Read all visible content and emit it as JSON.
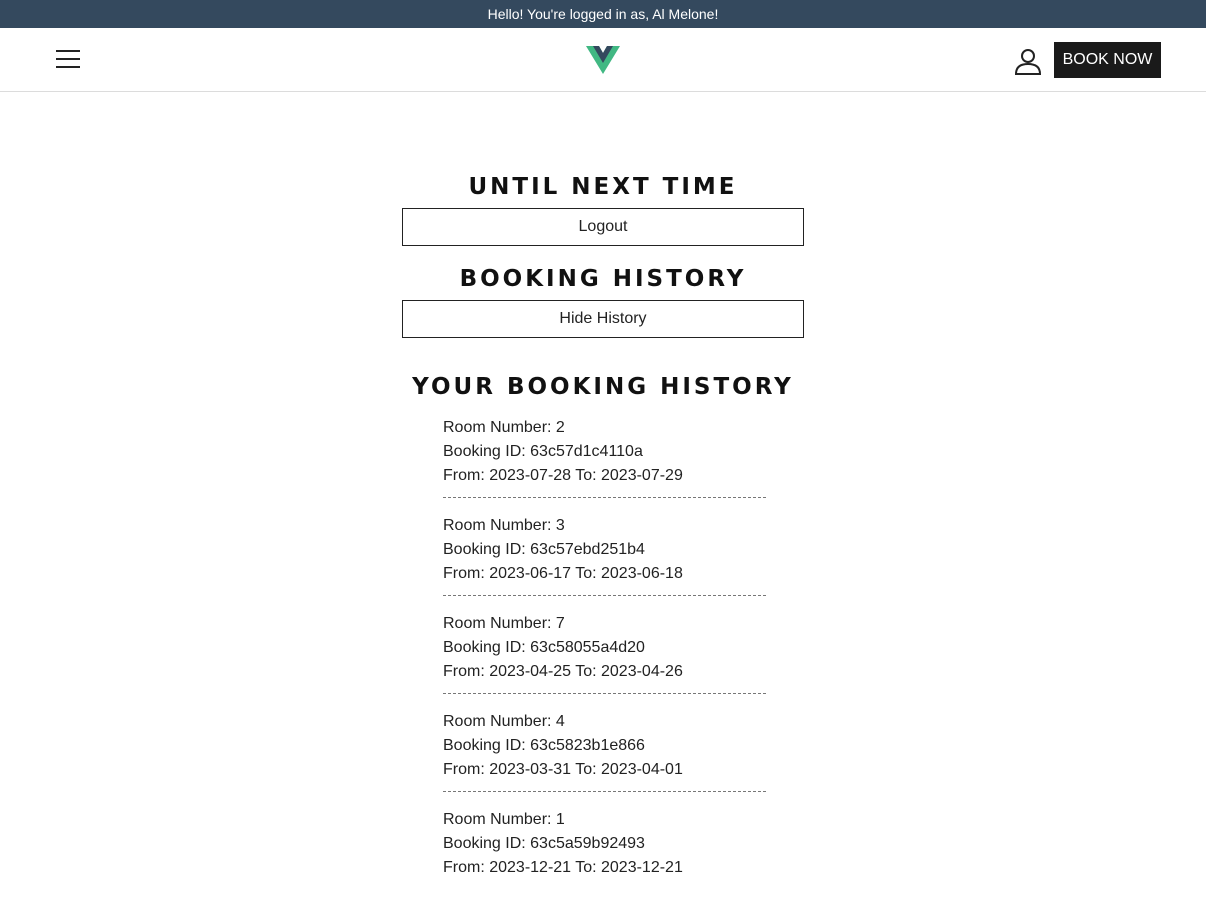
{
  "banner": {
    "text": "Hello! You're logged in as, Al Melone!"
  },
  "header": {
    "menu_icon": "hamburger-menu-icon",
    "logo_icon": "vue-logo-icon",
    "user_icon": "user-account-icon",
    "book_now_label": "BOOK NOW"
  },
  "logout_section": {
    "title": "UNTIL NEXT TIME",
    "button_label": "Logout"
  },
  "history_section": {
    "title": "BOOKING HISTORY",
    "button_label": "Hide History",
    "list_title": "YOUR BOOKING HISTORY",
    "bookings": [
      {
        "room": "Room Number: 2",
        "id": "Booking ID: 63c57d1c4110a",
        "dates": "From: 2023-07-28 To: 2023-07-29"
      },
      {
        "room": "Room Number: 3",
        "id": "Booking ID: 63c57ebd251b4",
        "dates": "From: 2023-06-17 To: 2023-06-18"
      },
      {
        "room": "Room Number: 7",
        "id": "Booking ID: 63c58055a4d20",
        "dates": "From: 2023-04-25 To: 2023-04-26"
      },
      {
        "room": "Room Number: 4",
        "id": "Booking ID: 63c5823b1e866",
        "dates": "From: 2023-03-31 To: 2023-04-01"
      },
      {
        "room": "Room Number: 1",
        "id": "Booking ID: 63c5a59b92493",
        "dates": "From: 2023-12-21 To: 2023-12-21"
      }
    ]
  },
  "colors": {
    "banner_bg": "#34495e",
    "vue_green": "#41b883",
    "vue_dark": "#34495e",
    "button_dark": "#1a1a1a"
  }
}
